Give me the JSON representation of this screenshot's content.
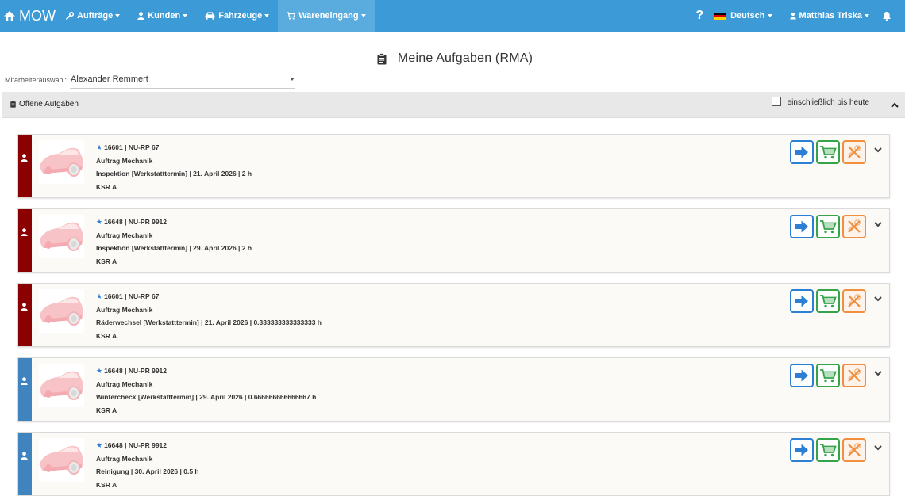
{
  "navbar": {
    "brand": "MOW",
    "items": [
      {
        "label": "Aufträge",
        "icon": "wrench-icon"
      },
      {
        "label": "Kunden",
        "icon": "user-icon"
      },
      {
        "label": "Fahrzeuge",
        "icon": "car-icon"
      },
      {
        "label": "Wareneingang",
        "icon": "cart-icon",
        "active": true
      }
    ],
    "help": "?",
    "language": "Deutsch",
    "user": "Matthias Triska"
  },
  "page": {
    "title": "Meine Aufgaben (RMA)"
  },
  "employee": {
    "label": "Mitarbeiterauswahl:",
    "value": "Alexander Remmert"
  },
  "panel": {
    "title": "Offene Aufgaben",
    "checkbox_label": "einschließlich bis heute",
    "checkbox_checked": false
  },
  "colors": {
    "navbar": "#3c9ad7",
    "overdue": "#8b0000",
    "upcoming": "#3f83bf",
    "go": "#2d7fd3",
    "cart": "#35a348",
    "cancel": "#ef8f3f"
  },
  "tasks": [
    {
      "id_plate": "16601 | NU-RP 67",
      "type": "Auftrag Mechanik",
      "detail": "Inspektion [Werkstatttermin] | 21. April 2026 | 2 h",
      "location": "KSR A",
      "status": "overdue"
    },
    {
      "id_plate": "16648 | NU-PR 9912",
      "type": "Auftrag Mechanik",
      "detail": "Inspektion [Werkstatttermin] | 29. April 2026 | 2 h",
      "location": "KSR A",
      "status": "overdue"
    },
    {
      "id_plate": "16601 | NU-RP 67",
      "type": "Auftrag Mechanik",
      "detail": "Räderwechsel [Werkstatttermin] | 21. April 2026 | 0.333333333333333 h",
      "location": "KSR A",
      "status": "overdue"
    },
    {
      "id_plate": "16648 | NU-PR 9912",
      "type": "Auftrag Mechanik",
      "detail": "Wintercheck [Werkstatttermin] | 29. April 2026 | 0.666666666666667 h",
      "location": "KSR A",
      "status": "upcoming"
    },
    {
      "id_plate": "16648 | NU-PR 9912",
      "type": "Auftrag Mechanik",
      "detail": "Reinigung | 30. April 2026 | 0.5 h",
      "location": "KSR A",
      "status": "upcoming"
    }
  ]
}
